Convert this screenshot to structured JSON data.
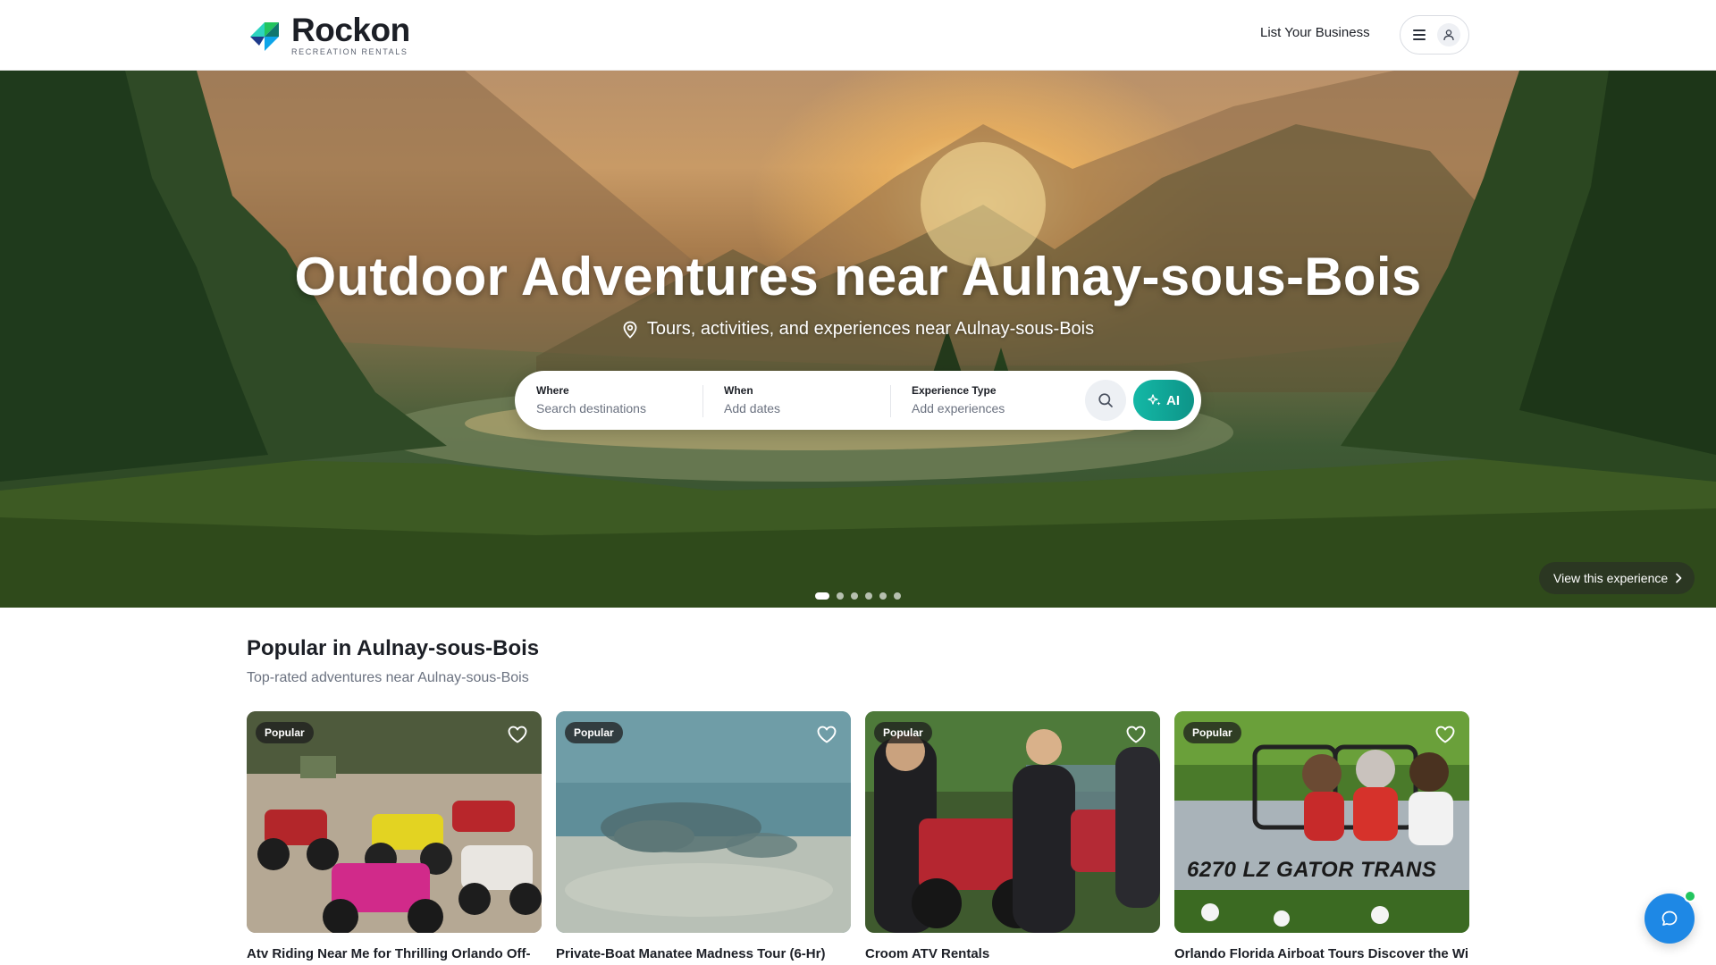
{
  "header": {
    "brand_name": "Rockon",
    "brand_tagline": "RECREATION RENTALS",
    "list_business_label": "List Your Business",
    "menu_icon": "hamburger-icon",
    "user_icon": "user-icon"
  },
  "hero": {
    "title": "Outdoor Adventures near Aulnay-sous-Bois",
    "subtitle": "Tours, activities, and experiences near Aulnay-sous-Bois",
    "search": {
      "where_label": "Where",
      "where_placeholder": "Search destinations",
      "when_label": "When",
      "when_placeholder": "Add dates",
      "type_label": "Experience Type",
      "type_placeholder": "Add experiences",
      "ai_label": "AI"
    },
    "view_experience_label": "View this experience",
    "slides_total": 6,
    "active_slide": 1
  },
  "popular": {
    "title": "Popular in Aulnay-sous-Bois",
    "subtitle": "Top-rated adventures near Aulnay-sous-Bois",
    "cards": [
      {
        "badge": "Popular",
        "title": "Atv Riding Near Me for Thrilling Orlando Off-"
      },
      {
        "badge": "Popular",
        "title": "Private-Boat Manatee Madness Tour (6-Hr)"
      },
      {
        "badge": "Popular",
        "title": "Croom ATV Rentals"
      },
      {
        "badge": "Popular",
        "title": "Orlando Florida Airboat Tours Discover the Wild"
      }
    ],
    "card4_boat_text": "6270 LZ  GATOR TRANS"
  },
  "colors": {
    "accent": "#14b8a6",
    "chat": "#1e88e5",
    "online": "#22c55e"
  }
}
